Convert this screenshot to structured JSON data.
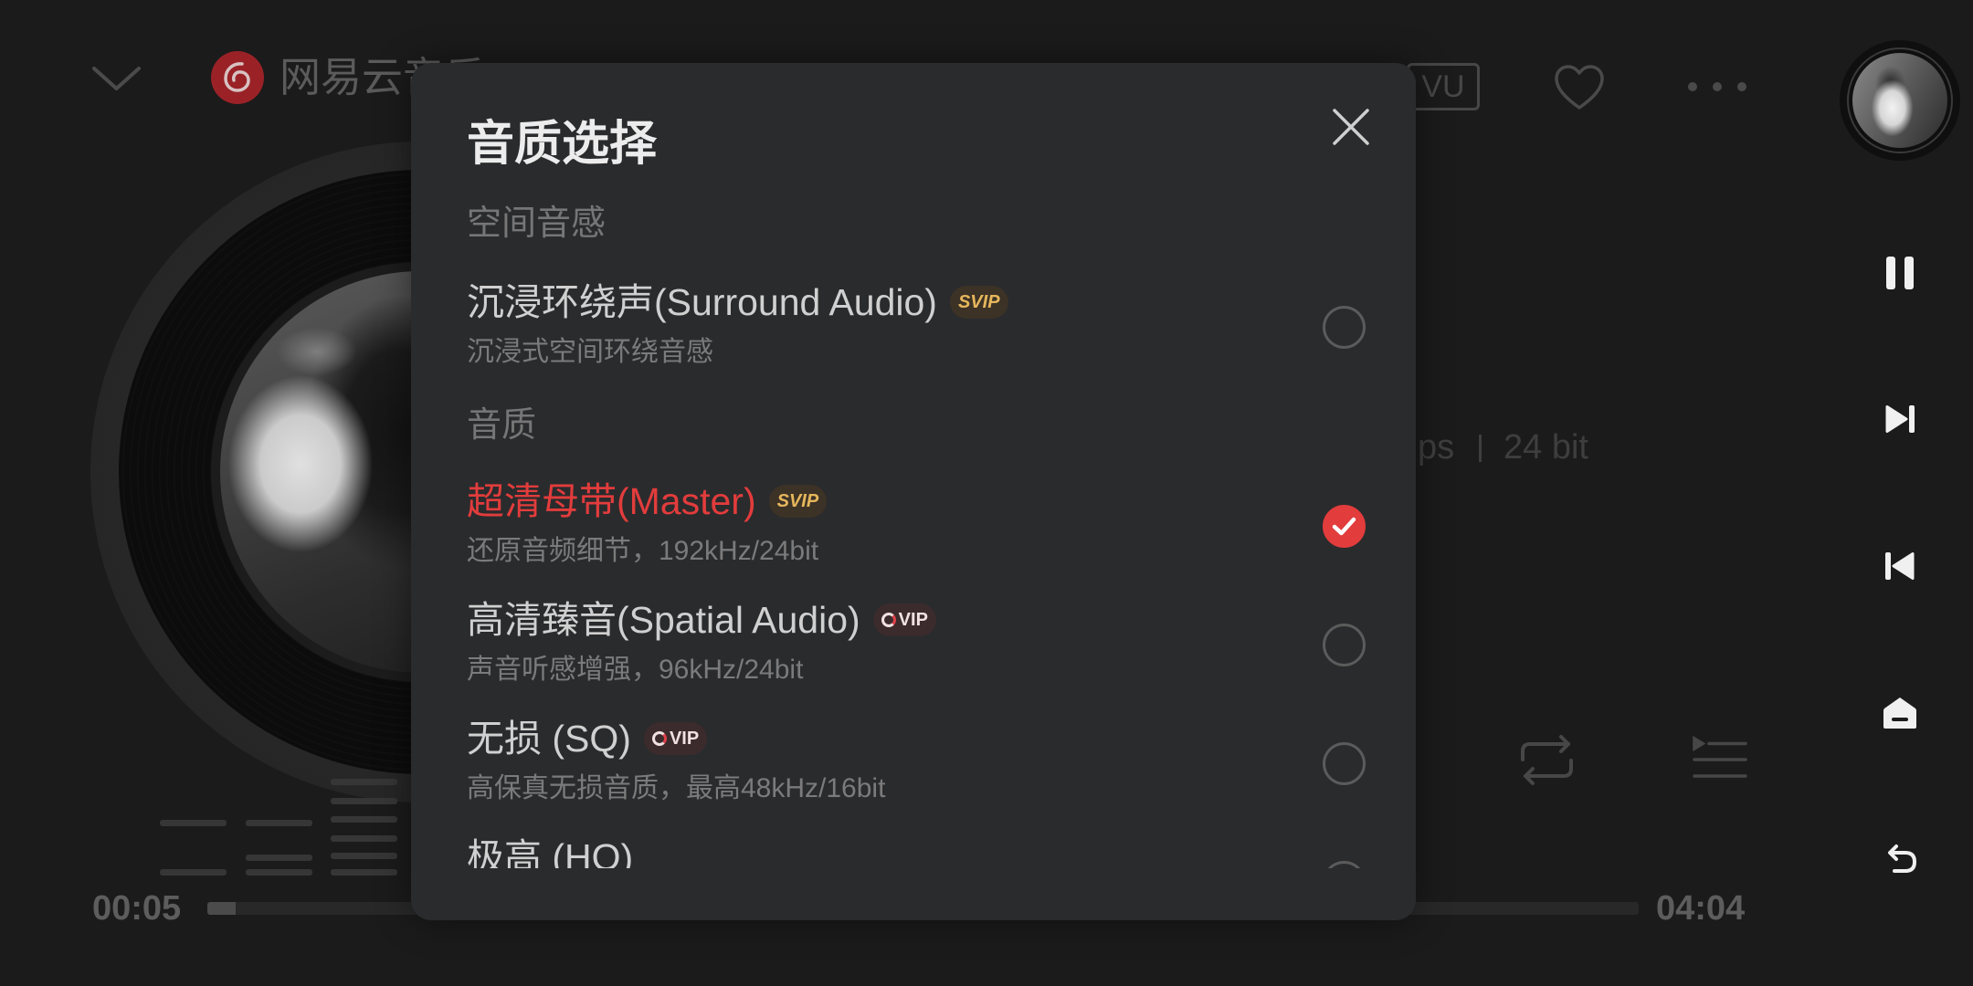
{
  "colors": {
    "accent_red": "#e23c3c",
    "svip_gold": "#e6b65c",
    "dialog_bg": "#2a2b2d",
    "background": "#1b1b1b"
  },
  "icons": {
    "collapse": "chevron-down-icon",
    "logo": "netease-logo-icon",
    "like": "heart-icon",
    "more": "more-icon",
    "repeat": "repeat-icon",
    "playlist": "playlist-icon",
    "close": "close-icon",
    "side_nav": [
      "pause-icon",
      "skip-next-icon",
      "skip-previous-icon",
      "home-icon",
      "back-icon"
    ]
  },
  "player": {
    "logo_text": "网易云音乐",
    "vu_label": "VU",
    "quality_fragment": "ps",
    "bit_depth": "24 bit",
    "current_time": "00:05",
    "total_time": "04:04",
    "progress_fraction": 0.02
  },
  "dialog": {
    "title": "音质选择",
    "sections": [
      {
        "header": "空间音感",
        "options": [
          {
            "label": "沉浸环绕声(Surround Audio)",
            "badge": "SVIP",
            "description": "沉浸式空间环绕音感",
            "selected": false
          }
        ]
      },
      {
        "header": "音质",
        "options": [
          {
            "label": "超清母带(Master)",
            "badge": "SVIP",
            "description": "还原音频细节，192kHz/24bit",
            "selected": true
          },
          {
            "label": "高清臻音(Spatial Audio)",
            "badge": "VIP",
            "description": "声音听感增强，96kHz/24bit",
            "selected": false
          },
          {
            "label": "无损 (SQ)",
            "badge": "VIP",
            "description": "高保真无损音质，最高48kHz/16bit",
            "selected": false
          },
          {
            "label": "极高 (HQ)",
            "selected": false
          }
        ]
      }
    ]
  }
}
